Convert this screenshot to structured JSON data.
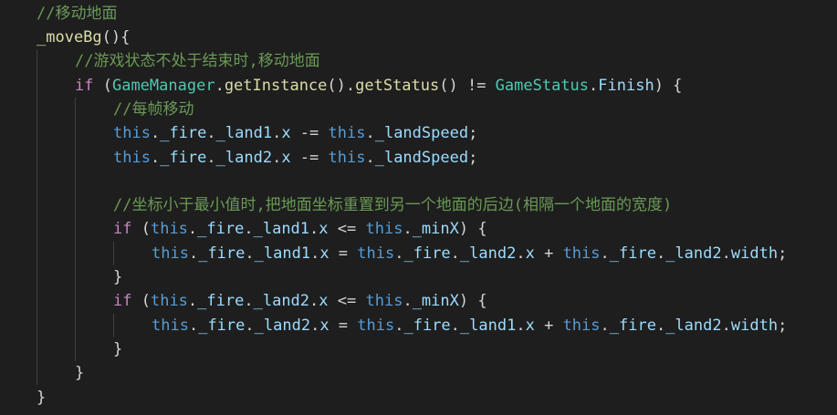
{
  "editor": {
    "lines": [
      [
        {
          "t": "//移动地面",
          "c": "comment"
        }
      ],
      [
        {
          "t": "_moveBg",
          "c": "fn"
        },
        {
          "t": "(){",
          "c": "punc"
        }
      ],
      [
        {
          "t": "//游戏状态不处于结束时,移动地面",
          "c": "comment"
        }
      ],
      [
        {
          "t": "if",
          "c": "ctrl"
        },
        {
          "t": " (",
          "c": "punc"
        },
        {
          "t": "GameManager",
          "c": "type"
        },
        {
          "t": ".",
          "c": "punc"
        },
        {
          "t": "getInstance",
          "c": "fn"
        },
        {
          "t": "().",
          "c": "punc"
        },
        {
          "t": "getStatus",
          "c": "fn"
        },
        {
          "t": "() != ",
          "c": "punc"
        },
        {
          "t": "GameStatus",
          "c": "type"
        },
        {
          "t": ".",
          "c": "punc"
        },
        {
          "t": "Finish",
          "c": "prop"
        },
        {
          "t": ") {",
          "c": "punc"
        }
      ],
      [
        {
          "t": "//每帧移动",
          "c": "comment"
        }
      ],
      [
        {
          "t": "this",
          "c": "kw"
        },
        {
          "t": ".",
          "c": "punc"
        },
        {
          "t": "_fire",
          "c": "prop"
        },
        {
          "t": ".",
          "c": "punc"
        },
        {
          "t": "_land1",
          "c": "prop"
        },
        {
          "t": ".",
          "c": "punc"
        },
        {
          "t": "x",
          "c": "prop"
        },
        {
          "t": " -= ",
          "c": "punc"
        },
        {
          "t": "this",
          "c": "kw"
        },
        {
          "t": ".",
          "c": "punc"
        },
        {
          "t": "_landSpeed",
          "c": "prop"
        },
        {
          "t": ";",
          "c": "punc"
        }
      ],
      [
        {
          "t": "this",
          "c": "kw"
        },
        {
          "t": ".",
          "c": "punc"
        },
        {
          "t": "_fire",
          "c": "prop"
        },
        {
          "t": ".",
          "c": "punc"
        },
        {
          "t": "_land2",
          "c": "prop"
        },
        {
          "t": ".",
          "c": "punc"
        },
        {
          "t": "x",
          "c": "prop"
        },
        {
          "t": " -= ",
          "c": "punc"
        },
        {
          "t": "this",
          "c": "kw"
        },
        {
          "t": ".",
          "c": "punc"
        },
        {
          "t": "_landSpeed",
          "c": "prop"
        },
        {
          "t": ";",
          "c": "punc"
        }
      ],
      [],
      [
        {
          "t": "//坐标小于最小值时,把地面坐标重置到另一个地面的后边(相隔一个地面的宽度)",
          "c": "comment"
        }
      ],
      [
        {
          "t": "if",
          "c": "ctrl"
        },
        {
          "t": " (",
          "c": "punc"
        },
        {
          "t": "this",
          "c": "kw"
        },
        {
          "t": ".",
          "c": "punc"
        },
        {
          "t": "_fire",
          "c": "prop"
        },
        {
          "t": ".",
          "c": "punc"
        },
        {
          "t": "_land1",
          "c": "prop"
        },
        {
          "t": ".",
          "c": "punc"
        },
        {
          "t": "x",
          "c": "prop"
        },
        {
          "t": " <= ",
          "c": "punc"
        },
        {
          "t": "this",
          "c": "kw"
        },
        {
          "t": ".",
          "c": "punc"
        },
        {
          "t": "_minX",
          "c": "prop"
        },
        {
          "t": ") {",
          "c": "punc"
        }
      ],
      [
        {
          "t": "this",
          "c": "kw"
        },
        {
          "t": ".",
          "c": "punc"
        },
        {
          "t": "_fire",
          "c": "prop"
        },
        {
          "t": ".",
          "c": "punc"
        },
        {
          "t": "_land1",
          "c": "prop"
        },
        {
          "t": ".",
          "c": "punc"
        },
        {
          "t": "x",
          "c": "prop"
        },
        {
          "t": " = ",
          "c": "punc"
        },
        {
          "t": "this",
          "c": "kw"
        },
        {
          "t": ".",
          "c": "punc"
        },
        {
          "t": "_fire",
          "c": "prop"
        },
        {
          "t": ".",
          "c": "punc"
        },
        {
          "t": "_land2",
          "c": "prop"
        },
        {
          "t": ".",
          "c": "punc"
        },
        {
          "t": "x",
          "c": "prop"
        },
        {
          "t": " + ",
          "c": "punc"
        },
        {
          "t": "this",
          "c": "kw"
        },
        {
          "t": ".",
          "c": "punc"
        },
        {
          "t": "_fire",
          "c": "prop"
        },
        {
          "t": ".",
          "c": "punc"
        },
        {
          "t": "_land2",
          "c": "prop"
        },
        {
          "t": ".",
          "c": "punc"
        },
        {
          "t": "width",
          "c": "prop"
        },
        {
          "t": ";",
          "c": "punc"
        }
      ],
      [
        {
          "t": "}",
          "c": "punc"
        }
      ],
      [
        {
          "t": "if",
          "c": "ctrl"
        },
        {
          "t": " (",
          "c": "punc"
        },
        {
          "t": "this",
          "c": "kw"
        },
        {
          "t": ".",
          "c": "punc"
        },
        {
          "t": "_fire",
          "c": "prop"
        },
        {
          "t": ".",
          "c": "punc"
        },
        {
          "t": "_land2",
          "c": "prop"
        },
        {
          "t": ".",
          "c": "punc"
        },
        {
          "t": "x",
          "c": "prop"
        },
        {
          "t": " <= ",
          "c": "punc"
        },
        {
          "t": "this",
          "c": "kw"
        },
        {
          "t": ".",
          "c": "punc"
        },
        {
          "t": "_minX",
          "c": "prop"
        },
        {
          "t": ") {",
          "c": "punc"
        }
      ],
      [
        {
          "t": "this",
          "c": "kw"
        },
        {
          "t": ".",
          "c": "punc"
        },
        {
          "t": "_fire",
          "c": "prop"
        },
        {
          "t": ".",
          "c": "punc"
        },
        {
          "t": "_land2",
          "c": "prop"
        },
        {
          "t": ".",
          "c": "punc"
        },
        {
          "t": "x",
          "c": "prop"
        },
        {
          "t": " = ",
          "c": "punc"
        },
        {
          "t": "this",
          "c": "kw"
        },
        {
          "t": ".",
          "c": "punc"
        },
        {
          "t": "_fire",
          "c": "prop"
        },
        {
          "t": ".",
          "c": "punc"
        },
        {
          "t": "_land1",
          "c": "prop"
        },
        {
          "t": ".",
          "c": "punc"
        },
        {
          "t": "x",
          "c": "prop"
        },
        {
          "t": " + ",
          "c": "punc"
        },
        {
          "t": "this",
          "c": "kw"
        },
        {
          "t": ".",
          "c": "punc"
        },
        {
          "t": "_fire",
          "c": "prop"
        },
        {
          "t": ".",
          "c": "punc"
        },
        {
          "t": "_land2",
          "c": "prop"
        },
        {
          "t": ".",
          "c": "punc"
        },
        {
          "t": "width",
          "c": "prop"
        },
        {
          "t": ";",
          "c": "punc"
        }
      ],
      [
        {
          "t": "}",
          "c": "punc"
        }
      ],
      [
        {
          "t": "}",
          "c": "punc"
        }
      ],
      [
        {
          "t": "}",
          "c": "punc"
        }
      ]
    ]
  },
  "theme": {
    "background": "#1e1e1e",
    "comment": "#6a9955",
    "keyword": "#569cd6",
    "control": "#c586c0",
    "function": "#dcdcaa",
    "type": "#4ec9b0",
    "property": "#9cdcfe",
    "punctuation": "#d4d4d4",
    "indent_guide": "#404040"
  }
}
